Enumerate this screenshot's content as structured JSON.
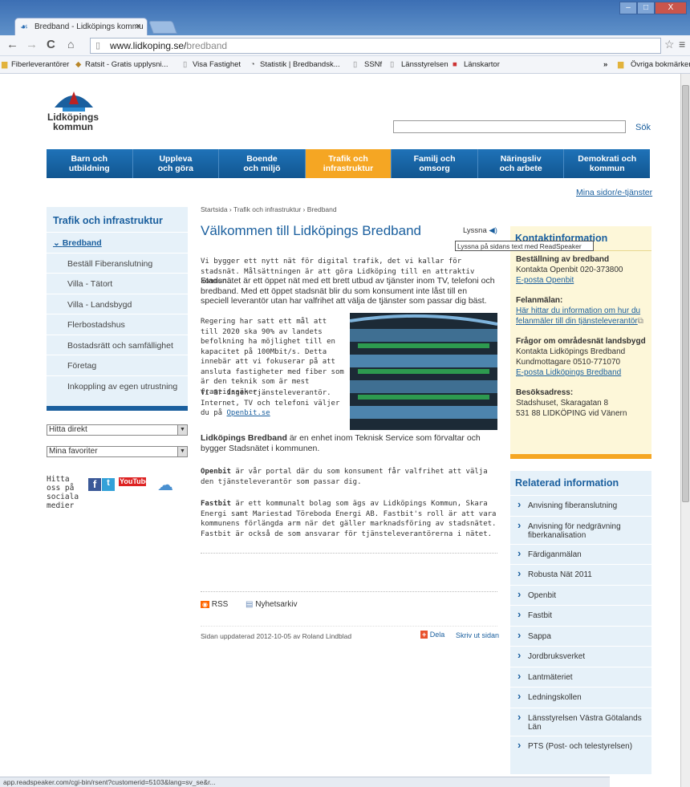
{
  "browser": {
    "tab_title": "Bredband - Lidköpings kommu",
    "tab_close": "×",
    "url_domain": "www.lidkoping.se/",
    "url_path": "bredband",
    "win_controls": [
      "–",
      "□",
      "X"
    ]
  },
  "bookmarks": {
    "items": [
      "Fiberleverantörer",
      "Ratsit - Gratis upplysni...",
      "Visa Fastighet",
      "Statistik | Bredbandsk...",
      "SSNf",
      "Länsstyrelsen",
      "Länskartor"
    ],
    "overflow": "»",
    "other": "Övriga bokmärken"
  },
  "site": {
    "logo_line1": "Lidköpings",
    "logo_line2": "kommun",
    "search_button": "Sök",
    "my_pages": "Mina sidor/e-tjänster"
  },
  "nav": {
    "items": [
      {
        "l1": "Barn och",
        "l2": "utbildning"
      },
      {
        "l1": "Uppleva",
        "l2": "och göra"
      },
      {
        "l1": "Boende",
        "l2": "och miljö"
      },
      {
        "l1": "Trafik och",
        "l2": "infrastruktur"
      },
      {
        "l1": "Familj och",
        "l2": "omsorg"
      },
      {
        "l1": "Näringsliv",
        "l2": "och arbete"
      },
      {
        "l1": "Demokrati och",
        "l2": "kommun"
      }
    ]
  },
  "sidebar": {
    "title": "Trafik och infrastruktur",
    "active": "Bredband",
    "items": [
      "Beställ Fiberanslutning",
      "Villa - Tätort",
      "Villa - Landsbygd",
      "Flerbostadshus",
      "Bostadsrätt och samfällighet",
      "Företag",
      "Inkoppling av egen utrustning"
    ],
    "select1": "Hitta direkt",
    "select2": "Mina favoriter",
    "social_text": "Hitta oss på sociala medier",
    "youtube": "YouTube"
  },
  "main": {
    "breadcrumb": "Startsida › Trafik och infrastruktur › Bredband",
    "title": "Välkommen till Lidköpings Bredband",
    "listen": "Lyssna",
    "tooltip": "Lyssna på sidans text med ReadSpeaker",
    "p1": "Vi bygger ett nytt nät för digital trafik, det vi kallar för stadsnät. Målsättningen är att göra Lidköping till en attraktiv kommun.",
    "p2": "Stadsnätet är ett öppet nät med ett brett utbud av tjänster inom TV, telefoni och bredband. Med ett öppet stadsnät blir du som konsument inte låst till en speciell leverantör utan har valfrihet att välja de tjänster som passar dig bäst.",
    "p3": "Regering har satt ett mål att till 2020 ska 90% av landets befolkning ha möjlighet till en kapacitet på 100Mbit/s. Detta innebär att vi fokuserar på att ansluta fastigheter med fiber som är den teknik som är mest framtidssäker.",
    "p4a": "Vi är ingen tjänsteleverantör. Internet, TV och telefoni väljer du på ",
    "p4link": "Openbit.se",
    "p5b": "Lidköpings Bredband",
    "p5": " är en enhet inom Teknisk Service som förvaltar och bygger Stadsnätet i kommunen.",
    "p6b": "Openbit",
    "p6": " är vår portal där du som konsument får valfrihet att välja den tjänsteleverantör som passar dig.",
    "p7b": "Fastbit",
    "p7": " är ett kommunalt bolag som ägs av Lidköpings Kommun, Skara Energi samt Mariestad Töreboda Energi AB. Fastbit's roll är att vara kommunens förlängda arm när det gäller marknadsföring av stadsnätet. Fastbit är också de som ansvarar för tjänsteleverantörerna i nätet.",
    "rss": "RSS",
    "archive": "Nyhetsarkiv",
    "updated": "Sidan uppdaterad 2012-10-05 av Roland Lindblad",
    "share": "Dela",
    "print": "Skriv ut sidan"
  },
  "contact": {
    "title": "Kontaktinformation",
    "order_h": "Beställning av bredband",
    "order_phone": "Kontakta Openbit 020-373800",
    "order_mail": "E-posta Openbit",
    "fault_h": "Felanmälan:",
    "fault_link": "Här hittar du information om hur du felanmäler till din tjänsteleverantör",
    "area_h": "Frågor om områdesnät landsbygd",
    "area_1": "Kontakta Lidköpings Bredband",
    "area_2": "Kundmottagare 0510-771070",
    "area_mail": "E-posta Lidköpings Bredband",
    "visit_h": "Besöksadress:",
    "visit_1": "Stadshuset, Skaragatan 8",
    "visit_2": "531 88 LIDKÖPING vid Vänern"
  },
  "related": {
    "title": "Relaterad information",
    "items": [
      "Anvisning fiberanslutning",
      "Anvisning för nedgrävning fiberkanalisation",
      "Färdiganmälan",
      "Robusta Nät 2011",
      "Openbit",
      "Fastbit",
      "Sappa",
      "Jordbruksverket",
      "Lantmäteriet",
      "Ledningskollen",
      "Länsstyrelsen Västra Götalands Län",
      "PTS (Post- och telestyrelsen)"
    ]
  },
  "status": {
    "text": "app.readspeaker.com/cgi-bin/rsent?customerid=5103&lang=sv_se&r..."
  },
  "colors": {
    "brand": "#1a5f9e",
    "accent": "#f5a623",
    "chrome": "#5f91c9"
  }
}
